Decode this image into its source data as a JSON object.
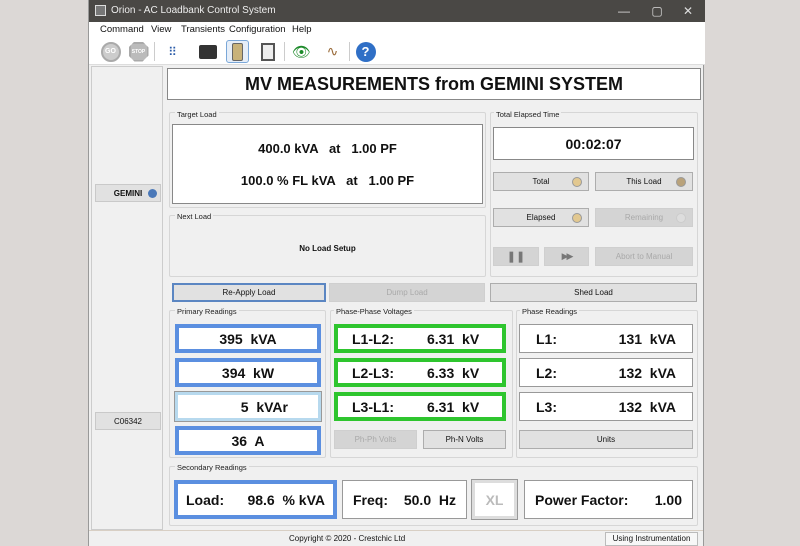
{
  "window": {
    "title": "Orion - AC Loadbank Control System",
    "controls": [
      "—",
      "▢",
      "✕"
    ]
  },
  "menu": [
    {
      "label": "Command"
    },
    {
      "label": "View"
    },
    {
      "label": "Transients"
    },
    {
      "label": "Configuration"
    },
    {
      "label": "Help"
    }
  ],
  "toolbar": {
    "go": "GO",
    "stop": "STOP",
    "icons": [
      "go-icon",
      "stop-icon",
      "keypad-icon",
      "loadbank-icon",
      "instrumentation-icon",
      "report-icon",
      "monitor-eye-icon",
      "waveform-icon",
      "help-icon"
    ]
  },
  "left": {
    "system": "GEMINI",
    "serial": "C06342",
    "led_color": "#4a78b8"
  },
  "header": {
    "title": "MV MEASUREMENTS from GEMINI SYSTEM"
  },
  "target": {
    "label": "Target Load",
    "line1": "400.0 kVA   at   1.00 PF",
    "line2": "100.0 % FL kVA   at   1.00 PF"
  },
  "next": {
    "label": "Next Load",
    "text": "No Load Setup"
  },
  "elapsed": {
    "label": "Total Elapsed Time",
    "time": "00:02:07",
    "total": "Total",
    "this_load": "This Load",
    "elapsed": "Elapsed",
    "remaining": "Remaining",
    "pause": "❚❚",
    "forward": "▶▶",
    "abort": "Abort to Manual"
  },
  "actions": {
    "reapply": "Re-Apply Load",
    "dump": "Dump Load",
    "shed": "Shed Load"
  },
  "primary": {
    "label": "Primary Readings",
    "values": [
      "395  kVA",
      "394  kW",
      "5  kVAr",
      "36  A"
    ]
  },
  "phase_phase": {
    "label": "Phase-Phase Voltages",
    "rows": [
      {
        "name": "L1-L2:",
        "value": "6.31  kV"
      },
      {
        "name": "L2-L3:",
        "value": "6.33  kV"
      },
      {
        "name": "L3-L1:",
        "value": "6.31  kV"
      }
    ],
    "phph": "Ph-Ph Volts",
    "phn": "Ph-N Volts"
  },
  "phase": {
    "label": "Phase Readings",
    "rows": [
      {
        "name": "L1:",
        "value": "131  kVA"
      },
      {
        "name": "L2:",
        "value": "132  kVA"
      },
      {
        "name": "L3:",
        "value": "132  kVA"
      }
    ],
    "units": "Units"
  },
  "secondary": {
    "label": "Secondary Readings",
    "load_name": "Load:",
    "load_value": "98.6  % kVA",
    "freq_name": "Freq:",
    "freq_value": "50.0  Hz",
    "xl": "XL",
    "pf_name": "Power Factor:",
    "pf_value": "1.00"
  },
  "status": {
    "copyright": "Copyright © 2020 - Crestchic Ltd",
    "mode": "Using Instrumentation"
  }
}
